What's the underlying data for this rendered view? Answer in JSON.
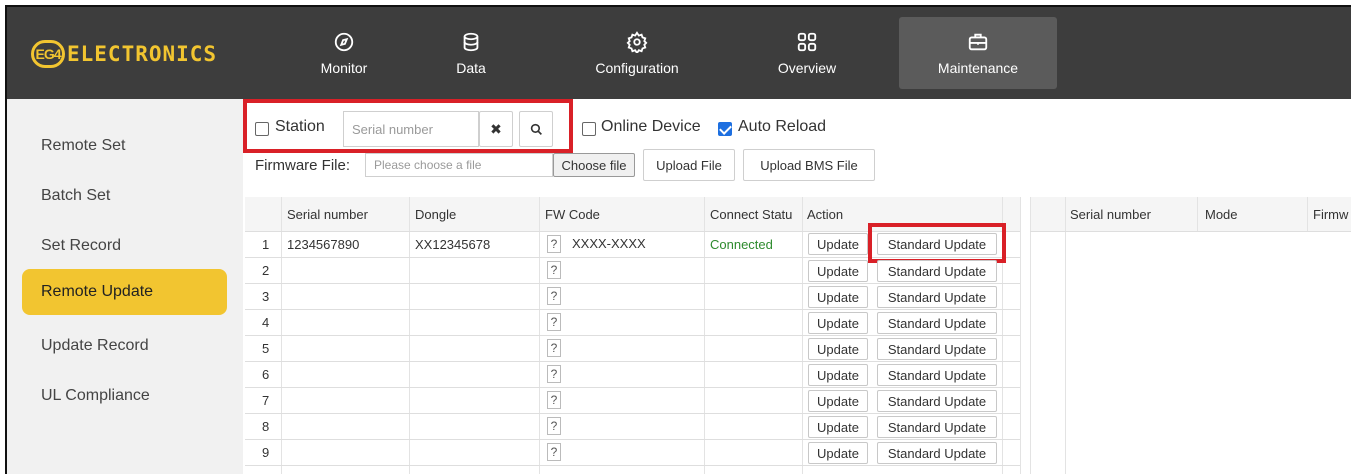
{
  "brand": {
    "badge": "EG4",
    "name": "ELECTRONICS"
  },
  "nav": [
    {
      "label": "Monitor",
      "icon": "compass-icon"
    },
    {
      "label": "Data",
      "icon": "database-icon"
    },
    {
      "label": "Configuration",
      "icon": "gear-icon"
    },
    {
      "label": "Overview",
      "icon": "grid-icon"
    },
    {
      "label": "Maintenance",
      "icon": "toolbox-icon",
      "active": true
    }
  ],
  "sidebar": [
    {
      "label": "Remote Set"
    },
    {
      "label": "Batch Set"
    },
    {
      "label": "Set Record"
    },
    {
      "label": "Remote Update",
      "active": true
    },
    {
      "label": "Update Record"
    },
    {
      "label": "UL Compliance"
    }
  ],
  "toolbar": {
    "station_label": "Station",
    "serial_placeholder": "Serial number",
    "clear_glyph": "✖",
    "online_label": "Online Device",
    "auto_reload_label": "Auto Reload",
    "firmware_label": "Firmware File:",
    "firmware_placeholder": "Please choose a file",
    "choose_file": "Choose file",
    "upload_file": "Upload File",
    "upload_bms": "Upload BMS File"
  },
  "table": {
    "headers": [
      "Serial number",
      "Dongle",
      "FW Code",
      "Connect Statu",
      "Action"
    ],
    "rows": [
      {
        "num": "1",
        "serial": "1234567890",
        "dongle": "XX12345678",
        "fw": "XXXX-XXXX",
        "status": "Connected"
      },
      {
        "num": "2",
        "serial": "",
        "dongle": "",
        "fw": "",
        "status": ""
      },
      {
        "num": "3",
        "serial": "",
        "dongle": "",
        "fw": "",
        "status": ""
      },
      {
        "num": "4",
        "serial": "",
        "dongle": "",
        "fw": "",
        "status": ""
      },
      {
        "num": "5",
        "serial": "",
        "dongle": "",
        "fw": "",
        "status": ""
      },
      {
        "num": "6",
        "serial": "",
        "dongle": "",
        "fw": "",
        "status": ""
      },
      {
        "num": "7",
        "serial": "",
        "dongle": "",
        "fw": "",
        "status": ""
      },
      {
        "num": "8",
        "serial": "",
        "dongle": "",
        "fw": "",
        "status": ""
      },
      {
        "num": "9",
        "serial": "",
        "dongle": "",
        "fw": "",
        "status": ""
      }
    ],
    "q_label": "?",
    "update_label": "Update",
    "standard_update_label": "Standard Update"
  },
  "right_table": {
    "headers": [
      "Serial number",
      "Mode",
      "Firmw"
    ]
  },
  "colors": {
    "accent": "#f2c530",
    "highlight": "#d92027",
    "connected": "#2e8b2e",
    "topbar": "#3d3d3d"
  }
}
